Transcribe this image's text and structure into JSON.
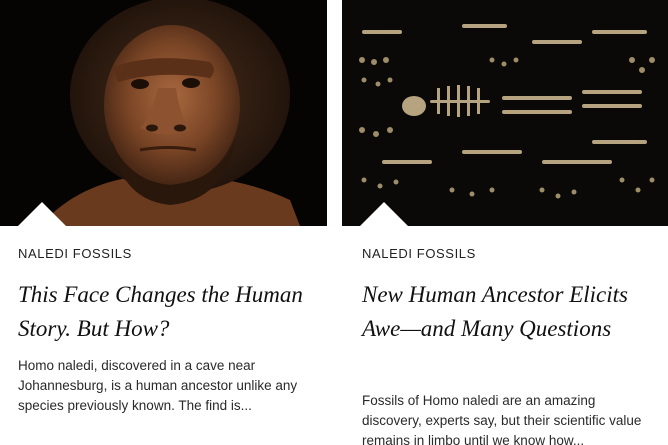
{
  "cards": [
    {
      "kicker": "NALEDI FOSSILS",
      "headline": "This Face Changes the Human Story. But How?",
      "dek": "Homo naledi, discovered in a cave near Johannesburg, is a human ancestor unlike any species previously known. The find is..."
    },
    {
      "kicker": "NALEDI FOSSILS",
      "headline": "New Human Ancestor Elicits Awe—and Many Questions",
      "dek": "Fossils of Homo naledi are an amazing discovery, experts say, but their scientific value remains in limbo until we know how..."
    }
  ]
}
